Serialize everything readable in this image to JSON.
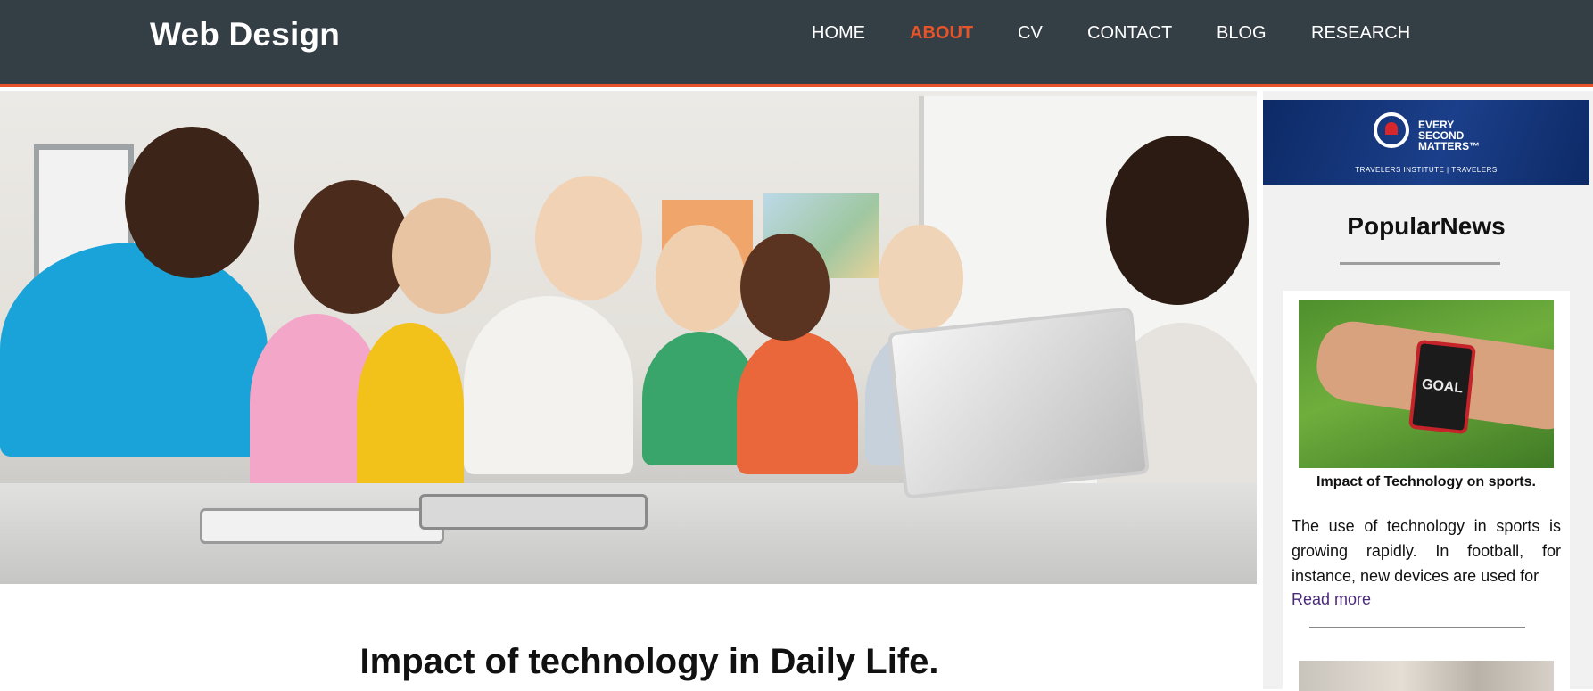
{
  "header": {
    "brand": "Web Design",
    "nav": [
      "HOME",
      "ABOUT",
      "CV",
      "CONTACT",
      "BLOG",
      "RESEARCH"
    ],
    "active_nav": "ABOUT"
  },
  "colors": {
    "header_bg": "#343e45",
    "accent": "#e8542a",
    "link": "#4b2a7a"
  },
  "hero": {
    "image": "classroom-students-with-teacher-tablet-photo"
  },
  "sidebar": {
    "ad": {
      "title": "EVERY\nSECOND\nMATTERS™",
      "footer": "TRAVELERS INSTITUTE | TRAVELERS",
      "icon": "stopwatch-umbrella-icon"
    },
    "title": "PopularNews",
    "news": [
      {
        "image": "smartwatch-goal-photo",
        "watch_text": "GOAL",
        "caption": "Impact of Technology on sports.",
        "excerpt": "The use of technology in sports is growing rapidly. In football, for instance, new devices are used for",
        "read_more": "Read more"
      }
    ]
  },
  "main": {
    "article_title": "Impact of technology in Daily Life."
  }
}
